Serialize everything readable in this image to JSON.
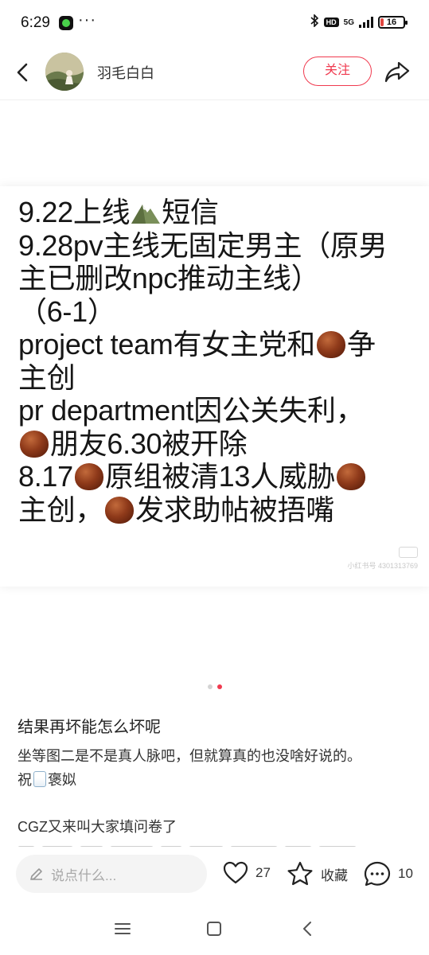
{
  "status_bar": {
    "time": "6:29",
    "more": "···",
    "hd": "HD",
    "network": "5G",
    "battery": "16",
    "battery_level": 0.16,
    "battery_color": "#e0463f"
  },
  "header": {
    "author_name": "羽毛白白",
    "follow_label": "关注",
    "accent_color": "#f03a4f",
    "icons": [
      "back-icon",
      "share-icon"
    ]
  },
  "image": {
    "lines": [
      {
        "segments": [
          {
            "text": "9.22上线"
          },
          {
            "icon": "mountain-icon"
          },
          {
            "text": "短信"
          }
        ]
      },
      {
        "segments": [
          {
            "text": "9.28pv主线无固定男主（原男"
          }
        ]
      },
      {
        "segments": [
          {
            "text": "主已删改npc推动主线）"
          }
        ]
      },
      {
        "segments": [
          {
            "text": "（6-1）"
          }
        ]
      },
      {
        "segments": [
          {
            "text": "project team有女主党和"
          },
          {
            "icon": "chestnut-icon"
          },
          {
            "text": "争"
          }
        ]
      },
      {
        "segments": [
          {
            "text": "主创"
          }
        ]
      },
      {
        "segments": [
          {
            "text": "pr department因公关失利，"
          }
        ]
      },
      {
        "segments": [
          {
            "icon": "chestnut-icon"
          },
          {
            "text": "朋友6.30被开除"
          }
        ]
      },
      {
        "segments": [
          {
            "text": "8.17"
          },
          {
            "icon": "chestnut-icon"
          },
          {
            "text": "原组被清13人威胁"
          },
          {
            "icon": "chestnut-icon"
          }
        ]
      },
      {
        "segments": [
          {
            "text": "主创，"
          },
          {
            "icon": "chestnut-icon"
          },
          {
            "text": "发求助帖被捂嘴"
          }
        ]
      }
    ],
    "page_count": 2,
    "active_page": 2
  },
  "post": {
    "title": "结果再坏能怎么坏呢",
    "body_line1": "坐等图二是不是真人脉吧，但就算真的也没啥好说的。",
    "body_line2_prefix": "祝",
    "body_line2_suffix": "褒姒",
    "extra_line": "CGZ又来叫大家填问卷了"
  },
  "action_bar": {
    "comment_placeholder": "说点什么...",
    "like_count": "27",
    "collect_label": "收藏",
    "comment_count": "10"
  },
  "system_nav": {
    "icons": [
      "menu-icon",
      "home-icon",
      "back-icon"
    ]
  }
}
